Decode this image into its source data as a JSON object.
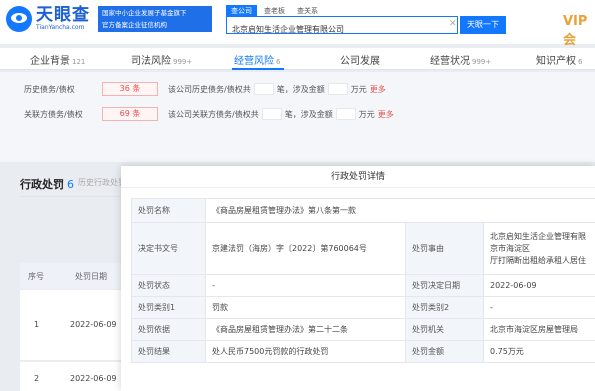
{
  "header": {
    "logo_cn": "天眼查",
    "logo_en": "TianYancha.com",
    "badge_line1": "国家中小企业发展子基金旗下",
    "badge_line2": "官方备案企业征信机构",
    "search_tabs": [
      "查公司",
      "查老板",
      "查关系"
    ],
    "search_value": "北京启知生活企业管理有限公司",
    "search_button": "天眼一下",
    "vip": "VIP会"
  },
  "nav": [
    {
      "label": "企业背景",
      "count": "121"
    },
    {
      "label": "司法风险",
      "count": "999+"
    },
    {
      "label": "经营风险",
      "count": "6"
    },
    {
      "label": "公司发展",
      "count": ""
    },
    {
      "label": "经营状况",
      "count": "999+"
    },
    {
      "label": "知识产权",
      "count": "6"
    }
  ],
  "summary": [
    {
      "label": "历史债务/债权",
      "count": "36 条",
      "text1": "该公司历史债务/债权共",
      "text2": "笔，涉及金额",
      "text3": "万元",
      "more": "更多"
    },
    {
      "label": "关联方债务/债权",
      "count": "69 条",
      "text1": "该公司关联方债务/债权共",
      "text2": "笔，涉及金额",
      "text3": "万元",
      "more": "更多"
    }
  ],
  "section": {
    "title": "行政处罚",
    "count": "6",
    "sub": "历史行政处罚"
  },
  "list": {
    "headers": [
      "序号",
      "处罚日期"
    ],
    "row1": {
      "index": "1",
      "date": "2022-06-09"
    },
    "row2": {
      "index": "2",
      "date": "2022-06-09"
    }
  },
  "modal": {
    "title": "行政处罚详情",
    "penalty_name_label": "处罚名称",
    "penalty_name": "《商品房屋租赁管理办法》第八条第一款",
    "doc_no_label": "决定书文号",
    "doc_no": "京建法罚（海房）字〔2022〕第760064号",
    "cause_label": "处罚事由",
    "cause_lines": [
      "北京启知生活企业管理有限",
      "京市海淀区",
      "厅打隔断出租给承租人居住"
    ],
    "status_label": "处罚状态",
    "status": "-",
    "decision_date_label": "处罚决定日期",
    "decision_date": "2022-06-09",
    "type1_label": "处罚类别1",
    "type1": "罚款",
    "type2_label": "处罚类别2",
    "type2": "-",
    "basis_label": "处罚依据",
    "basis": "《商品房屋租赁管理办法》第二十二条",
    "authority_label": "处罚机关",
    "authority": "北京市海淀区房屋管理局",
    "result_label": "处罚结果",
    "result": "处人民币7500元罚款的行政处罚",
    "amount_label": "处罚金额",
    "amount": "0.75万元"
  },
  "colors": {
    "accent": "#1478ff",
    "danger": "#e85050",
    "vip": "#e8a23a"
  }
}
